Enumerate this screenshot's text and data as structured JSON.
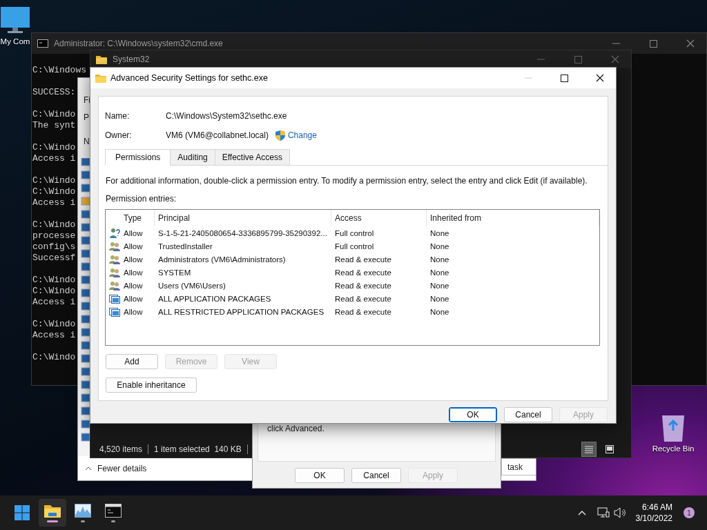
{
  "desktop_icons": [
    {
      "kind": "computer",
      "label": "My Com"
    },
    {
      "kind": "recycle",
      "label": "Recycle Bin"
    }
  ],
  "cmd": {
    "title": "Administrator: C:\\Windows\\system32\\cmd.exe",
    "blocks": [
      [
        "C:\\Windows"
      ],
      [
        "SUCCESS:"
      ],
      [
        "C:\\Windo",
        "The synt"
      ],
      [
        "C:\\Windo",
        "Access i"
      ],
      [
        "C:\\Windo",
        "C:\\Windo",
        "Access i"
      ],
      [
        "C:\\Windo",
        "processe",
        "config\\s",
        "Successf"
      ],
      [
        "C:\\Windo",
        "C:\\Windo",
        "Access i"
      ],
      [
        "C:\\Windo",
        "Access i"
      ],
      [
        "C:\\Windo"
      ]
    ]
  },
  "task_manager": {
    "menu_fragments": [
      "Fi",
      "P",
      "N"
    ],
    "fewer_details": "Fewer details",
    "end_task": "task"
  },
  "explorer": {
    "title": "System32",
    "status": [
      "4,520 items",
      "1 item selected  140 KB"
    ],
    "views": [
      {
        "kind": "details",
        "selected": true
      },
      {
        "kind": "tiles",
        "selected": false
      }
    ]
  },
  "properties": {
    "text": "click Advanced.",
    "buttons": [
      {
        "label": "OK",
        "disabled": false,
        "default": false
      },
      {
        "label": "Cancel",
        "disabled": false,
        "default": false
      },
      {
        "label": "Apply",
        "disabled": true,
        "default": false
      }
    ]
  },
  "dialog": {
    "title": "Advanced Security Settings for sethc.exe",
    "minimize_disabled": true,
    "name_label": "Name:",
    "name_value": "C:\\Windows\\System32\\sethc.exe",
    "owner_label": "Owner:",
    "owner_value": "VM6 (VM6@collabnet.local)",
    "change_link": "Change",
    "tabs": [
      {
        "label": "Permissions",
        "selected": true
      },
      {
        "label": "Auditing",
        "selected": false
      },
      {
        "label": "Effective Access",
        "selected": false
      }
    ],
    "info": "For additional information, double-click a permission entry. To modify a permission entry, select the entry and click Edit (if available).",
    "entries_label": "Permission entries:",
    "columns": [
      "Type",
      "Principal",
      "Access",
      "Inherited from"
    ],
    "rows": [
      {
        "kind": "unknown",
        "type": "Allow",
        "principal": "S-1-5-21-2405080654-3336895799-35290392...",
        "access": "Full control",
        "inherited": "None"
      },
      {
        "kind": "group",
        "type": "Allow",
        "principal": "TrustedInstaller",
        "access": "Full control",
        "inherited": "None"
      },
      {
        "kind": "group",
        "type": "Allow",
        "principal": "Administrators (VM6\\Administrators)",
        "access": "Read & execute",
        "inherited": "None"
      },
      {
        "kind": "group",
        "type": "Allow",
        "principal": "SYSTEM",
        "access": "Read & execute",
        "inherited": "None"
      },
      {
        "kind": "group",
        "type": "Allow",
        "principal": "Users (VM6\\Users)",
        "access": "Read & execute",
        "inherited": "None"
      },
      {
        "kind": "package",
        "type": "Allow",
        "principal": "ALL APPLICATION PACKAGES",
        "access": "Read & execute",
        "inherited": "None"
      },
      {
        "kind": "package",
        "type": "Allow",
        "principal": "ALL RESTRICTED APPLICATION PACKAGES",
        "access": "Read & execute",
        "inherited": "None"
      }
    ],
    "entry_buttons": [
      {
        "label": "Add",
        "disabled": false
      },
      {
        "label": "Remove",
        "disabled": true
      },
      {
        "label": "View",
        "disabled": true
      }
    ],
    "inheritance_button": "Enable inheritance",
    "buttons": [
      {
        "label": "OK",
        "disabled": false,
        "default": true
      },
      {
        "label": "Cancel",
        "disabled": false,
        "default": false
      },
      {
        "label": "Apply",
        "disabled": true,
        "default": false
      }
    ]
  },
  "taskbar": {
    "apps": [
      {
        "kind": "start",
        "selected": false
      },
      {
        "kind": "explorer",
        "selected": true
      },
      {
        "kind": "taskmgr",
        "selected": false
      },
      {
        "kind": "terminal",
        "selected": false
      }
    ],
    "time": "6:46 AM",
    "date": "3/10/2022",
    "notifications": "1"
  }
}
